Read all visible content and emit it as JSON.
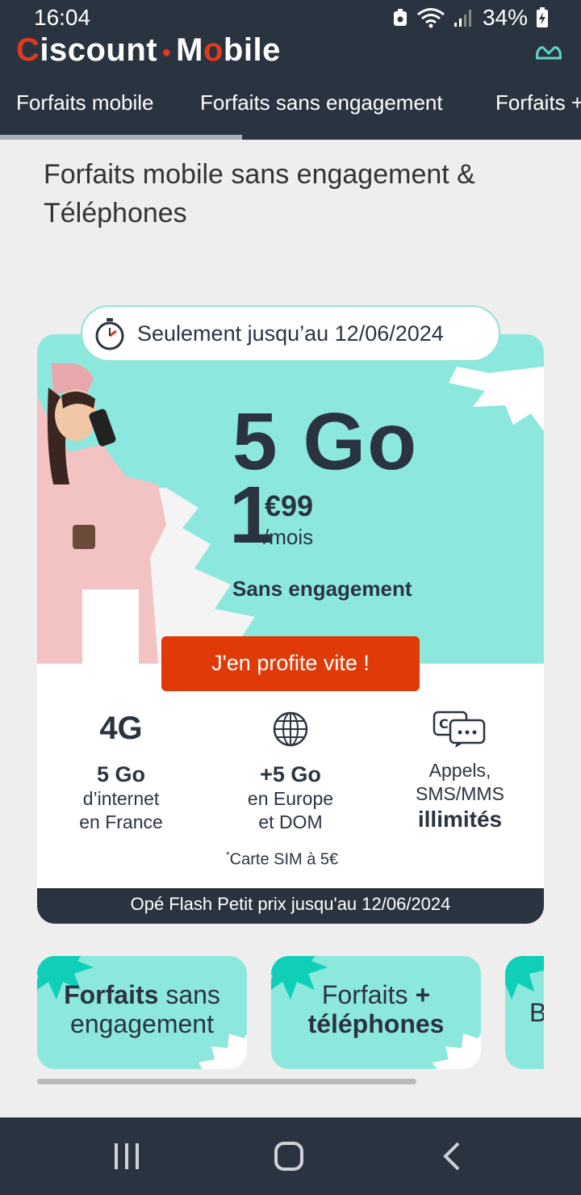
{
  "status_bar": {
    "time": "16:04",
    "battery": "34%",
    "icons": [
      "notification-icon",
      "wifi-icon",
      "signal-icon",
      "battery-charging-icon"
    ]
  },
  "header": {
    "logo_parts": {
      "first": "C",
      "rest": "iscount",
      "dot": "•",
      "mobile_m": "M",
      "mobile_o": "o",
      "mobile_rest": "bile"
    },
    "tabs": [
      "Forfaits mobile",
      "Forfaits sans engagement",
      "Forfaits +"
    ]
  },
  "main": {
    "title": "Forfaits mobile sans engagement & Téléphones",
    "promo": {
      "timer_text": "Seulement jusqu’au 12/06/2024",
      "data_amount": "5 Go",
      "price_int": "1",
      "price_dec": "€99",
      "price_per": "/mois",
      "commitment": "Sans engagement",
      "cta_label": "J'en profite vite !",
      "features": [
        {
          "head": "4G",
          "bold": "5 Go",
          "lines": [
            "d’internet",
            "en France"
          ]
        },
        {
          "head_icon": "globe-icon",
          "bold": "+5 Go",
          "lines": [
            "en Europe",
            "et DOM"
          ]
        },
        {
          "head_icon": "chat-bubbles-icon",
          "lines": [
            "Appels,",
            "SMS/MMS"
          ],
          "bold_bottom": "illimités"
        }
      ],
      "footnote_mark": "*",
      "footnote": "Carte SIM à 5€",
      "footer": "Opé Flash Petit prix jusqu'au 12/06/2024"
    },
    "categories": [
      {
        "bold": "Forfaits",
        "normal": " sans",
        "line2": "engagement"
      },
      {
        "line1": "Forfaits ",
        "bold1": "+",
        "line2_bold": "téléphones"
      },
      {
        "partial": "B"
      }
    ]
  },
  "colors": {
    "navy": "#2a3441",
    "teal": "#8ce8dd",
    "brand_red": "#e03a1e",
    "cta": "#e03a08"
  },
  "nav_bar": {
    "icons": [
      "recent-apps-icon",
      "home-icon",
      "back-icon"
    ]
  }
}
